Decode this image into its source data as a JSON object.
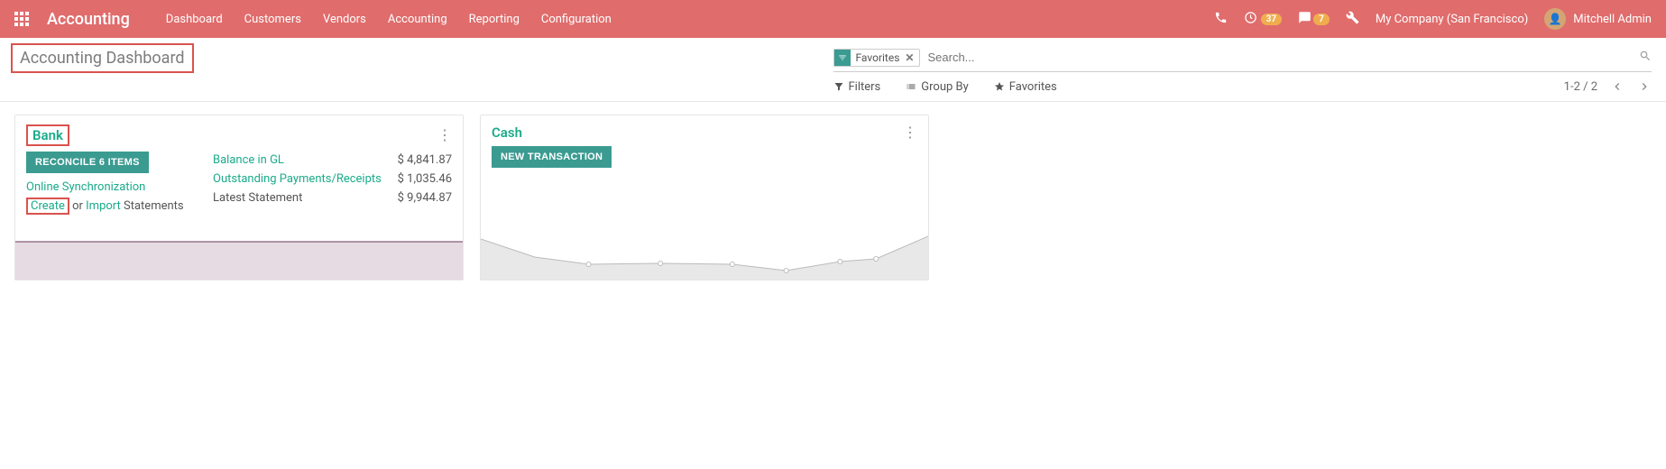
{
  "topnav": {
    "brand": "Accounting",
    "items": [
      "Dashboard",
      "Customers",
      "Vendors",
      "Accounting",
      "Reporting",
      "Configuration"
    ],
    "timer_badge": "37",
    "msg_badge": "7",
    "company": "My Company (San Francisco)",
    "user": "Mitchell Admin"
  },
  "breadcrumb": {
    "title": "Accounting Dashboard"
  },
  "search": {
    "favorite_chip": "Favorites",
    "placeholder": "Search...",
    "filters_label": "Filters",
    "groupby_label": "Group By",
    "favorites_label": "Favorites",
    "pager": "1-2 / 2"
  },
  "cards": {
    "bank": {
      "title": "Bank",
      "reconcile_btn": "RECONCILE 6 ITEMS",
      "online_sync": "Online Synchronization",
      "create": "Create",
      "or": " or ",
      "import": "Import",
      "statements_suffix": " Statements",
      "balance_label": "Balance in GL",
      "balance_val": "$ 4,841.87",
      "outstanding_label": "Outstanding Payments/Receipts",
      "outstanding_val": "$ 1,035.46",
      "latest_label": "Latest Statement",
      "latest_val": "$ 9,944.87"
    },
    "cash": {
      "title": "Cash",
      "new_txn_btn": "NEW TRANSACTION"
    }
  }
}
